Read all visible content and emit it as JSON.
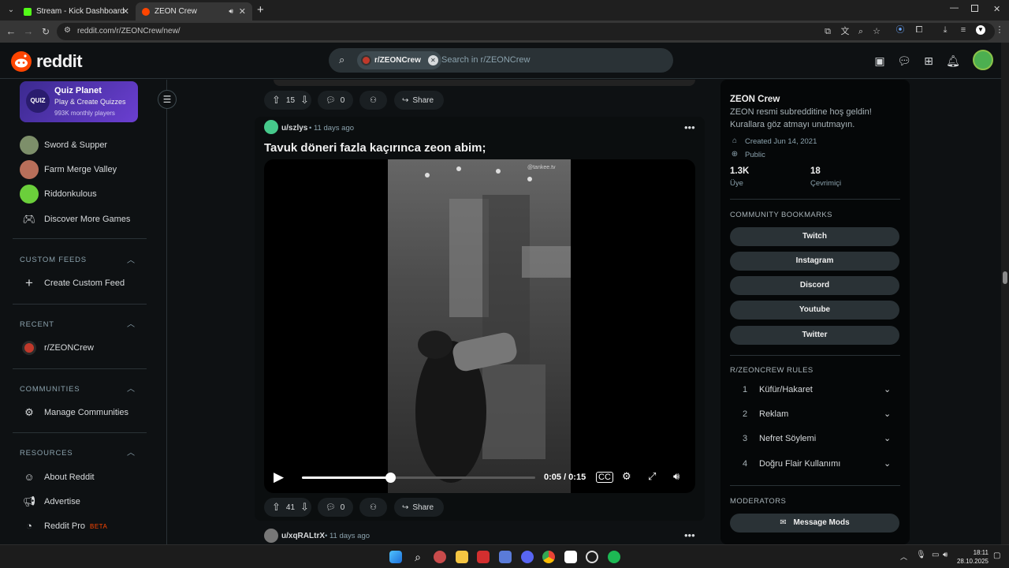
{
  "browser": {
    "tabs": [
      {
        "label": "Stream - Kick Dashboard",
        "fav_color": "#53fc18",
        "active": false
      },
      {
        "label": "ZEON Crew",
        "fav_color": "#ff4500",
        "active": true
      }
    ],
    "new_tab": "+",
    "url": "reddit.com/r/ZEONCrew/new/"
  },
  "reddit": {
    "logo": "reddit",
    "search": {
      "chip": "r/ZEONCrew",
      "placeholder": "Search in r/ZEONCrew"
    }
  },
  "left_nav": {
    "promo": {
      "icon_text": "QUIZ",
      "title": "Quiz Planet",
      "subtitle": "Play & Create Quizzes",
      "players": "993K monthly players"
    },
    "games": [
      {
        "label": "Sword & Supper",
        "icon": "game-icon"
      },
      {
        "label": "Farm Merge Valley",
        "icon": "game-icon"
      },
      {
        "label": "Riddonkulous",
        "icon": "game-icon"
      },
      {
        "label": "Discover More Games",
        "icon": "gamepad-icon"
      }
    ],
    "custom_feeds": {
      "header": "CUSTOM FEEDS",
      "item": "Create Custom Feed"
    },
    "recent": {
      "header": "RECENT",
      "item": "r/ZEONCrew"
    },
    "communities": {
      "header": "COMMUNITIES",
      "item": "Manage Communities"
    },
    "resources": {
      "header": "RESOURCES",
      "items": [
        "About Reddit",
        "Advertise",
        "Reddit Pro"
      ],
      "beta": "BETA"
    }
  },
  "feed": {
    "prev_post_actions": {
      "upvotes": "15",
      "comments": "0",
      "share": "Share"
    },
    "post": {
      "user": "u/szlys",
      "time": "• 11 days ago",
      "title": "Tavuk döneri fazla kaçırınca zeon abim;",
      "video": {
        "watermark": "@tankee.tv",
        "time": "0:05 / 0:15",
        "progress": 0.38
      },
      "upvotes": "41",
      "comments": "0",
      "share": "Share"
    },
    "next_post": {
      "user": "u/xqRALtrX",
      "time": "• 11 days ago"
    }
  },
  "right_sidebar": {
    "name": "ZEON Crew",
    "description": "ZEON resmi subredditine hoş geldin! Kurallara göz atmayı unutmayın.",
    "created": "Created Jun 14, 2021",
    "visibility": "Public",
    "members": {
      "value": "1.3K",
      "label": "Üye"
    },
    "online": {
      "value": "18",
      "label": "Çevrimiçi"
    },
    "bookmarks_header": "COMMUNITY BOOKMARKS",
    "bookmarks": [
      "Twitch",
      "Instagram",
      "Discord",
      "Youtube",
      "Twitter"
    ],
    "rules_header": "R/ZEONCREW RULES",
    "rules": [
      {
        "n": "1",
        "text": "Küfür/Hakaret"
      },
      {
        "n": "2",
        "text": "Reklam"
      },
      {
        "n": "3",
        "text": "Nefret Söylemi"
      },
      {
        "n": "4",
        "text": "Doğru Flair Kullanımı"
      }
    ],
    "moderators_header": "MODERATORS",
    "message_mods": "Message Mods"
  },
  "taskbar": {
    "time": "18:11",
    "date": "28.10.2025"
  },
  "colors": {
    "accent": "#ff4500",
    "bg": "#0e1113",
    "pill": "#2a3236"
  }
}
